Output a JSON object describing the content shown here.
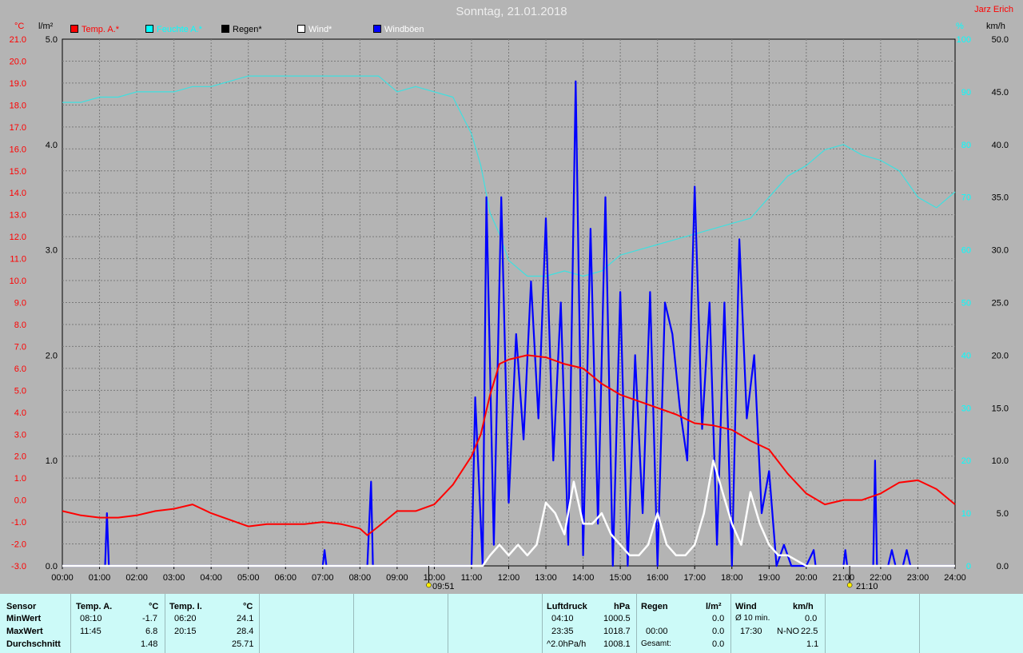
{
  "header": {
    "title": "Sonntag, 21.01.2018",
    "author": "Jarz Erich",
    "unit_temp": "°C",
    "unit_rain": "l/m²",
    "unit_humidity": "%",
    "unit_wind": "km/h"
  },
  "legend": [
    {
      "label": "Temp. A.*",
      "color": "#ff0000"
    },
    {
      "label": "Feuchte A.*",
      "color": "#00ffff"
    },
    {
      "label": "Regen*",
      "color": "#000000"
    },
    {
      "label": "Wind*",
      "color": "#ffffff"
    },
    {
      "label": "Windböen",
      "color": "#0000ff"
    }
  ],
  "colors": {
    "temperature": "#ff0000",
    "humidity": "#3ee0e0",
    "wind": "#ffffff",
    "gusts": "#0000ff",
    "grid": "#7a7a7a",
    "plot_bg": "#b4b4b4",
    "stats_bg": "#ccfaf8"
  },
  "markers": [
    {
      "label": "09:51"
    },
    {
      "label": "21:10"
    }
  ],
  "chart_data": {
    "type": "line",
    "title": "Sonntag, 21.01.2018",
    "xlim": [
      0,
      24
    ],
    "x_ticks": [
      "00:00",
      "01:00",
      "02:00",
      "03:00",
      "04:00",
      "05:00",
      "06:00",
      "07:00",
      "08:00",
      "09:00",
      "10:00",
      "11:00",
      "12:00",
      "13:00",
      "14:00",
      "15:00",
      "16:00",
      "17:00",
      "18:00",
      "19:00",
      "20:00",
      "21:00",
      "22:00",
      "23:00",
      "24:00"
    ],
    "axes": {
      "temp": {
        "label": "°C",
        "range": [
          -3,
          21
        ],
        "ticks": [
          "-3.0",
          "-2.0",
          "-1.0",
          "0.0",
          "1.0",
          "2.0",
          "3.0",
          "4.0",
          "5.0",
          "6.0",
          "7.0",
          "8.0",
          "9.0",
          "10.0",
          "11.0",
          "12.0",
          "13.0",
          "14.0",
          "15.0",
          "16.0",
          "17.0",
          "18.0",
          "19.0",
          "20.0",
          "21.0"
        ]
      },
      "rain": {
        "label": "l/m²",
        "range": [
          0,
          5
        ],
        "ticks": [
          "0.0",
          "1.0",
          "2.0",
          "3.0",
          "4.0",
          "5.0"
        ]
      },
      "humidity": {
        "label": "%",
        "range": [
          0,
          100
        ],
        "ticks": [
          "0",
          "10",
          "20",
          "30",
          "40",
          "50",
          "60",
          "70",
          "80",
          "90",
          "100"
        ]
      },
      "wind": {
        "label": "km/h",
        "range": [
          0,
          50
        ],
        "ticks": [
          "0.0",
          "5.0",
          "10.0",
          "15.0",
          "20.0",
          "25.0",
          "30.0",
          "35.0",
          "40.0",
          "45.0",
          "50.0"
        ]
      }
    },
    "grid": true,
    "series": [
      {
        "name": "Temp. A.*",
        "axis": "temp",
        "x": [
          0,
          0.5,
          1,
          1.5,
          2,
          2.5,
          3,
          3.5,
          4,
          4.5,
          5,
          5.5,
          6,
          6.5,
          7,
          7.5,
          8,
          8.2,
          8.5,
          9,
          9.5,
          10,
          10.5,
          11,
          11.25,
          11.5,
          11.75,
          12,
          12.5,
          13,
          13.5,
          14,
          14.5,
          15,
          15.5,
          16,
          16.5,
          17,
          17.5,
          18,
          18.5,
          19,
          19.5,
          20,
          20.5,
          21,
          21.5,
          22,
          22.5,
          23,
          23.5,
          24
        ],
        "y": [
          -0.5,
          -0.7,
          -0.8,
          -0.8,
          -0.7,
          -0.5,
          -0.4,
          -0.2,
          -0.6,
          -0.9,
          -1.2,
          -1.1,
          -1.1,
          -1.1,
          -1.0,
          -1.1,
          -1.3,
          -1.6,
          -1.2,
          -0.5,
          -0.5,
          -0.2,
          0.7,
          2.0,
          3.0,
          4.8,
          6.2,
          6.4,
          6.6,
          6.5,
          6.2,
          6.0,
          5.3,
          4.8,
          4.5,
          4.2,
          3.9,
          3.5,
          3.4,
          3.2,
          2.7,
          2.3,
          1.2,
          0.3,
          -0.2,
          0.0,
          0.0,
          0.3,
          0.8,
          0.9,
          0.5,
          -0.2
        ]
      },
      {
        "name": "Feuchte A.*",
        "axis": "humidity",
        "x": [
          0,
          0.5,
          1,
          1.5,
          2,
          2.5,
          3,
          3.5,
          4,
          4.5,
          5,
          5.5,
          6,
          6.5,
          7,
          7.5,
          8,
          8.5,
          9,
          9.5,
          10,
          10.5,
          11,
          11.25,
          11.5,
          11.75,
          12,
          12.5,
          13,
          13.5,
          14,
          14.5,
          15,
          15.5,
          16,
          16.5,
          17,
          17.5,
          18,
          18.5,
          19,
          19.5,
          20,
          20.5,
          21,
          21.5,
          22,
          22.5,
          23,
          23.5,
          24
        ],
        "y": [
          88,
          88,
          89,
          89,
          90,
          90,
          90,
          91,
          91,
          92,
          93,
          93,
          93,
          93,
          93,
          93,
          93,
          93,
          90,
          91,
          90,
          89,
          82,
          76,
          67,
          63,
          58,
          55,
          55,
          56,
          55,
          56,
          59,
          60,
          61,
          62,
          63,
          64,
          65,
          66,
          70,
          74,
          76,
          79,
          80,
          78,
          77,
          75,
          70,
          68,
          71
        ]
      },
      {
        "name": "Wind*",
        "axis": "wind",
        "x": [
          0,
          11.3,
          11.5,
          11.75,
          12,
          12.25,
          12.5,
          12.75,
          13,
          13.25,
          13.5,
          13.75,
          14,
          14.25,
          14.5,
          14.75,
          15,
          15.25,
          15.5,
          15.75,
          16,
          16.25,
          16.5,
          16.75,
          17,
          17.25,
          17.5,
          17.75,
          18,
          18.25,
          18.5,
          18.75,
          19,
          19.25,
          19.5,
          19.75,
          20,
          20.25,
          24
        ],
        "y": [
          0,
          0,
          1,
          2,
          1,
          2,
          1,
          2,
          6,
          5,
          3,
          8,
          4,
          4,
          5,
          3,
          2,
          1,
          1,
          2,
          5,
          2,
          1,
          1,
          2,
          5,
          10,
          7,
          4,
          2,
          7,
          4,
          2,
          1,
          1,
          0.5,
          0,
          0,
          0
        ]
      },
      {
        "name": "Windböen",
        "axis": "wind",
        "x": [
          0,
          1.15,
          1.2,
          1.25,
          7.0,
          7.05,
          7.1,
          8.2,
          8.3,
          8.35,
          8.4,
          11.0,
          11.1,
          11.3,
          11.4,
          11.6,
          11.8,
          12.0,
          12.2,
          12.4,
          12.6,
          12.8,
          13.0,
          13.2,
          13.4,
          13.6,
          13.8,
          14.0,
          14.2,
          14.4,
          14.6,
          14.8,
          15.0,
          15.2,
          15.4,
          15.6,
          15.8,
          16.0,
          16.2,
          16.4,
          16.6,
          16.8,
          17.0,
          17.2,
          17.4,
          17.6,
          17.8,
          18.0,
          18.2,
          18.4,
          18.6,
          18.8,
          19.0,
          19.2,
          19.4,
          19.6,
          20.0,
          20.2,
          20.25,
          20.3,
          21.0,
          21.05,
          21.1,
          21.8,
          21.85,
          21.9,
          22.2,
          22.3,
          22.4,
          22.6,
          22.7,
          22.8,
          24
        ],
        "y": [
          0,
          0,
          5,
          0,
          0,
          1.5,
          0,
          0,
          8,
          0,
          0,
          0,
          16,
          0,
          35,
          2,
          35,
          6,
          22,
          12,
          27,
          14,
          33,
          10,
          25,
          2,
          46,
          1,
          32,
          4,
          35,
          0,
          26,
          0,
          20,
          5,
          26,
          0,
          25,
          22,
          15,
          10,
          36,
          13,
          25,
          2,
          25,
          0,
          31,
          14,
          20,
          5,
          9,
          0,
          2,
          0,
          0,
          1.5,
          0,
          0,
          0,
          1.5,
          0,
          0,
          10,
          0,
          0,
          1.5,
          0,
          0,
          1.5,
          0,
          0
        ]
      }
    ]
  },
  "stats": {
    "sensor": {
      "header": "Sensor",
      "rows": [
        "MinWert",
        "MaxWert",
        "Durchschnitt"
      ]
    },
    "temp_a": {
      "header": "Temp. A.",
      "unit": "°C",
      "min_time": "08:10",
      "min_val": "-1.7",
      "max_time": "11:45",
      "max_val": "6.8",
      "avg": "1.48"
    },
    "temp_i": {
      "header": "Temp. I.",
      "unit": "°C",
      "min_time": "06:20",
      "min_val": "24.1",
      "max_time": "20:15",
      "max_val": "28.4",
      "avg": "25.71"
    },
    "pressure": {
      "header": "Luftdruck",
      "unit": "hPa",
      "min_time": "04:10",
      "min_val": "1000.5",
      "max_time": "23:35",
      "max_val": "1018.7",
      "trend_label": "^2.0hPa/h",
      "trend_val": "1008.1"
    },
    "rain": {
      "header": "Regen",
      "unit": "l/m²",
      "r1_time": "",
      "r1_val": "0.0",
      "r2_time": "00:00",
      "r2_val": "0.0",
      "total_label": "Gesamt:",
      "total_val": "0.0"
    },
    "wind": {
      "header": "Wind",
      "unit": "km/h",
      "r1_label": "Ø 10 min.",
      "r1_val": "0.0",
      "r2_time": "17:30",
      "r2_dir": "N-NO",
      "r2_val": "22.5",
      "r3_val": "1.1"
    }
  }
}
